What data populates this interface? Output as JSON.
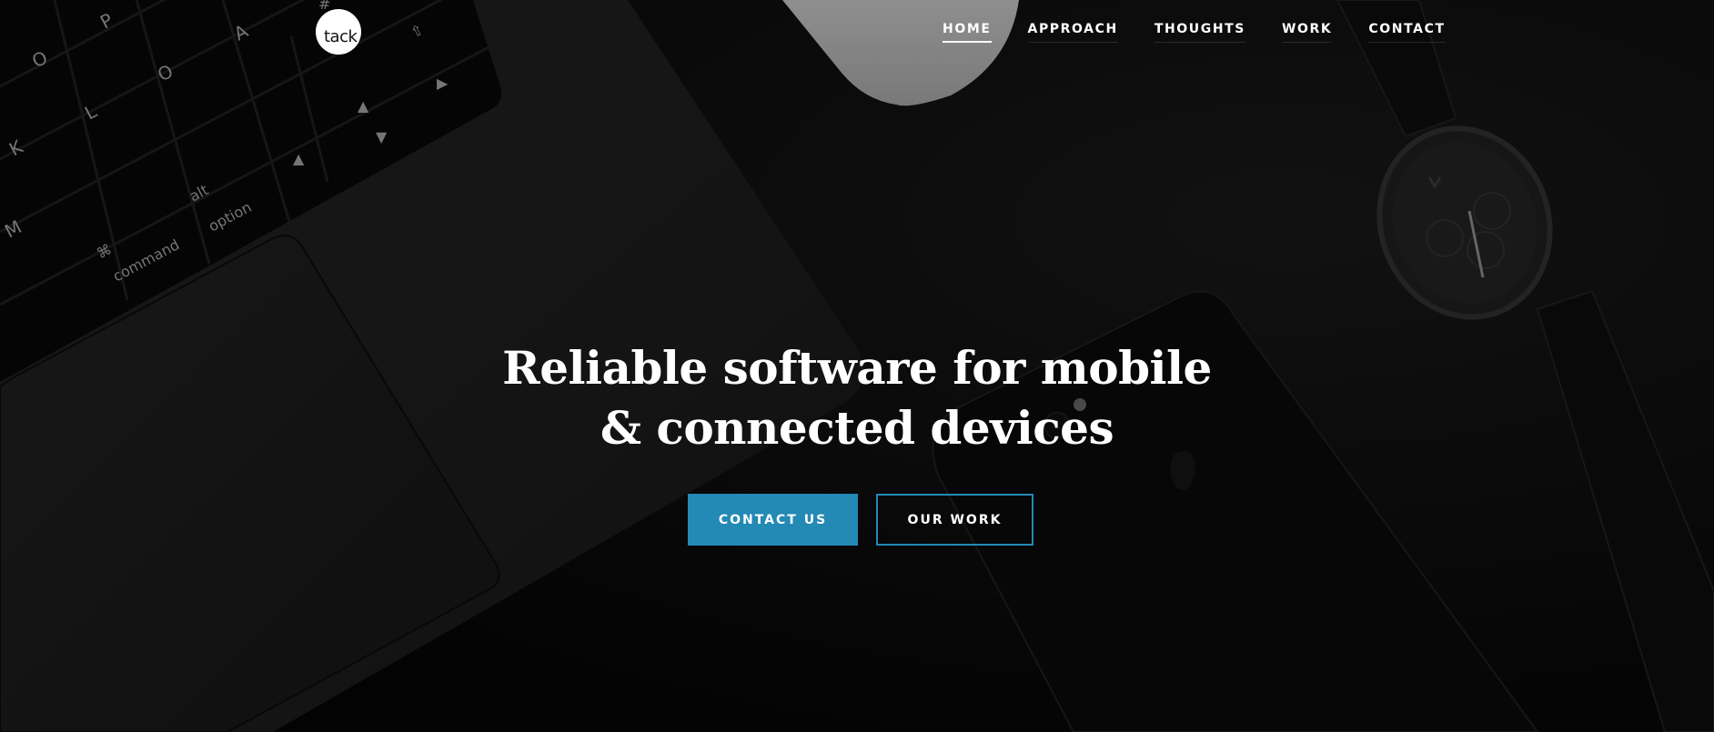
{
  "brand": {
    "logo_text": "tack",
    "logo_bg": "#ffffff"
  },
  "nav": {
    "items": [
      {
        "label": "HOME",
        "active": true
      },
      {
        "label": "APPROACH",
        "active": false
      },
      {
        "label": "THOUGHTS",
        "active": false
      },
      {
        "label": "WORK",
        "active": false
      },
      {
        "label": "CONTACT",
        "active": false
      }
    ]
  },
  "hero": {
    "title_line1": "Reliable software for mobile",
    "title_line2": "& connected devices",
    "primary_button": "CONTACT US",
    "secondary_button": "OUR WORK",
    "accent_color": "#2389b5",
    "background_image": "dark desk with laptop keyboard, mouse, smartphone and wristwatch"
  },
  "background_keys": {
    "labels": [
      "O",
      "P",
      "A",
      "K",
      "L",
      "O",
      "M",
      "command",
      "option",
      "alt",
      "⌘",
      "#"
    ]
  }
}
